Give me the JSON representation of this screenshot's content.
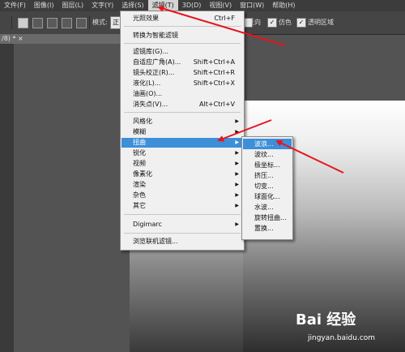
{
  "menubar": {
    "items": [
      {
        "label": "文件(F)"
      },
      {
        "label": "图像(I)"
      },
      {
        "label": "图层(L)"
      },
      {
        "label": "文字(Y)"
      },
      {
        "label": "选择(S)"
      },
      {
        "label": "滤镜(T)"
      },
      {
        "label": "3D(D)"
      },
      {
        "label": "视图(V)"
      },
      {
        "label": "窗口(W)"
      },
      {
        "label": "帮助(H)"
      }
    ]
  },
  "options": {
    "mode_label": "模式:",
    "mode_value": "正",
    "reverse_label": "反向",
    "dither_label": "仿色",
    "transparency_label": "透明区域"
  },
  "document_tab": {
    "label": "/8) * ×"
  },
  "filter_menu": {
    "items": [
      {
        "label": "光照效果",
        "shortcut": "Ctrl+F"
      },
      {
        "label": "转换为智能滤镜",
        "shortcut": ""
      },
      {
        "label": "滤镜库(G)...",
        "shortcut": ""
      },
      {
        "label": "自适应广角(A)...",
        "shortcut": "Shift+Ctrl+A"
      },
      {
        "label": "镜头校正(R)...",
        "shortcut": "Shift+Ctrl+R"
      },
      {
        "label": "液化(L)...",
        "shortcut": "Shift+Ctrl+X"
      },
      {
        "label": "油画(O)...",
        "shortcut": ""
      },
      {
        "label": "消失点(V)...",
        "shortcut": "Alt+Ctrl+V"
      },
      {
        "label": "风格化",
        "shortcut": ""
      },
      {
        "label": "模糊",
        "shortcut": ""
      },
      {
        "label": "扭曲",
        "shortcut": ""
      },
      {
        "label": "锐化",
        "shortcut": ""
      },
      {
        "label": "视频",
        "shortcut": ""
      },
      {
        "label": "像素化",
        "shortcut": ""
      },
      {
        "label": "渲染",
        "shortcut": ""
      },
      {
        "label": "杂色",
        "shortcut": ""
      },
      {
        "label": "其它",
        "shortcut": ""
      },
      {
        "label": "Digimarc",
        "shortcut": ""
      },
      {
        "label": "浏览联机滤镜...",
        "shortcut": ""
      }
    ],
    "submenu_arrow": "▶"
  },
  "distort_submenu": {
    "items": [
      {
        "label": "波浪..."
      },
      {
        "label": "波纹..."
      },
      {
        "label": "极坐标..."
      },
      {
        "label": "挤压..."
      },
      {
        "label": "切变..."
      },
      {
        "label": "球面化..."
      },
      {
        "label": "水波..."
      },
      {
        "label": "旋转扭曲..."
      },
      {
        "label": "置换..."
      }
    ]
  },
  "annotation_color": "#e8141c",
  "highlight_color": "#3d8fd8",
  "watermark": {
    "logo": "Bai 经验",
    "url": "jingyan.baidu.com"
  }
}
